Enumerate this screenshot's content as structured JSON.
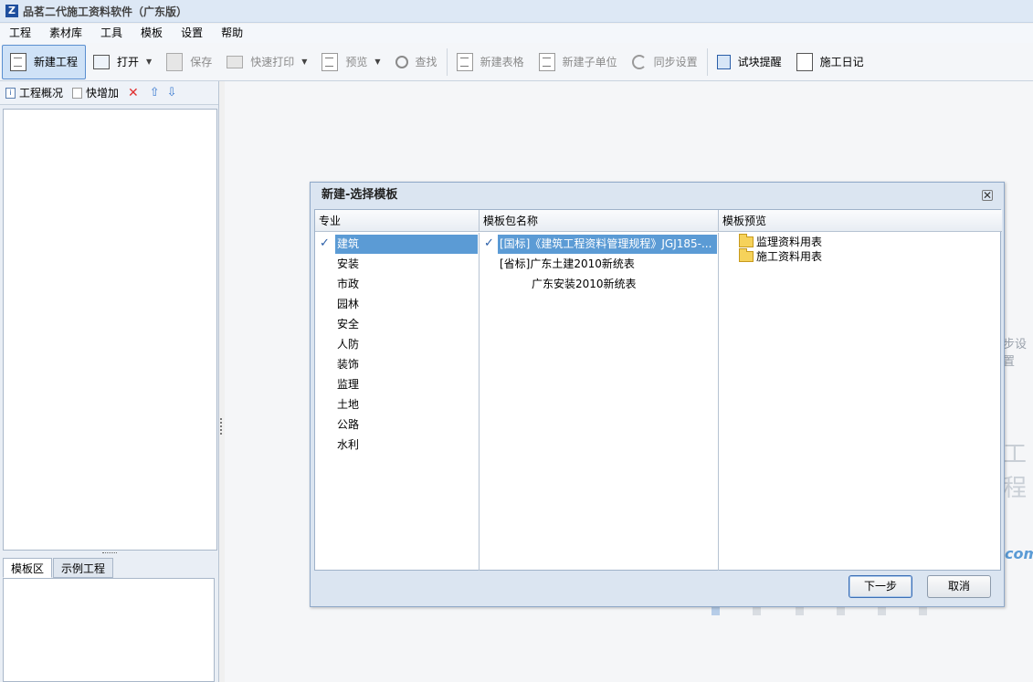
{
  "app": {
    "title": "品茗二代施工资料软件（广东版）",
    "logo_letter": "Z"
  },
  "menu": [
    "工程",
    "素材库",
    "工具",
    "模板",
    "设置",
    "帮助"
  ],
  "toolbar": {
    "new_project": "新建工程",
    "open": "打开",
    "save": "保存",
    "quick_print": "快速打印",
    "preview": "预览",
    "find": "查找",
    "new_table": "新建表格",
    "new_subunit": "新建子单位",
    "sync_settings": "同步设置",
    "test_block_reminder": "试块提醒",
    "construction_diary": "施工日记"
  },
  "left_panel": {
    "overview": "工程概况",
    "quick_add": "快增加",
    "tabs": [
      "模板区",
      "示例工程"
    ]
  },
  "background_fragments": {
    "sync": "步设置",
    "project": "工程",
    "domain": "com"
  },
  "dialog": {
    "title": "新建-选择模板",
    "close_glyph": "✕",
    "columns": {
      "specialty": "专业",
      "package_name": "模板包名称",
      "preview": "模板预览"
    },
    "specialties": [
      "建筑",
      "安装",
      "市政",
      "园林",
      "安全",
      "人防",
      "装饰",
      "监理",
      "土地",
      "公路",
      "水利"
    ],
    "selected_specialty": "建筑",
    "packages": [
      "[国标]《建筑工程资料管理规程》JGJ185-...",
      "[省标]广东土建2010新统表",
      "广东安装2010新统表"
    ],
    "selected_package": "[国标]《建筑工程资料管理规程》JGJ185-...",
    "preview_folders": [
      "监理资料用表",
      "施工资料用表"
    ],
    "next_button": "下一步",
    "cancel_button": "取消"
  },
  "colors": {
    "selection": "#5b9bd5",
    "accent": "#2a5ea8"
  }
}
